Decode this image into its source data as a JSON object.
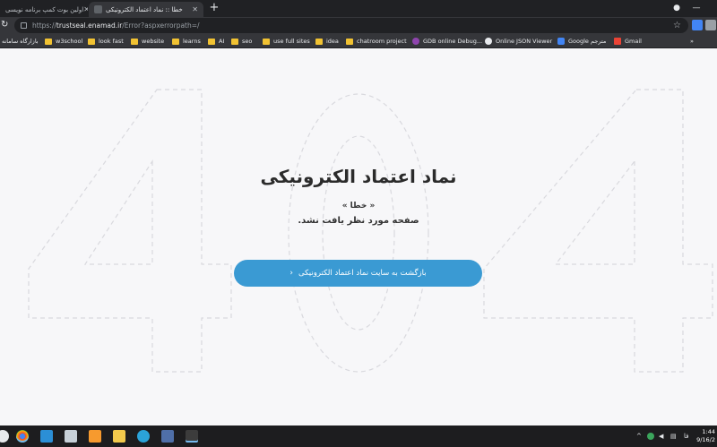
{
  "tabs": [
    {
      "label": "اولین بوت کمپ برنامه نویسی",
      "active": false
    },
    {
      "label": "خطا :: نماد اعتماد الکترونیکی",
      "active": true
    }
  ],
  "address_bar": {
    "scheme": "https://",
    "host": "trustseal.enamad.ir",
    "path": "/Error?aspxerrorpath=/"
  },
  "bookmarks": [
    {
      "label": "بازارگاه سامانه",
      "icon": "folder"
    },
    {
      "label": "w3school",
      "icon": "folder"
    },
    {
      "label": "look fast",
      "icon": "folder"
    },
    {
      "label": "website",
      "icon": "folder"
    },
    {
      "label": "learns",
      "icon": "folder"
    },
    {
      "label": "AI",
      "icon": "folder"
    },
    {
      "label": "seo",
      "icon": "folder"
    },
    {
      "label": "use full sites",
      "icon": "folder"
    },
    {
      "label": "idea",
      "icon": "folder"
    },
    {
      "label": "chatroom project",
      "icon": "folder"
    },
    {
      "label": "GDB online Debug...",
      "icon": "gdb-icon"
    },
    {
      "label": "Online JSON Viewer",
      "icon": "json-icon"
    },
    {
      "label": "Google مترجم",
      "icon": "translate-icon"
    },
    {
      "label": "Gmail",
      "icon": "gmail-icon"
    }
  ],
  "page": {
    "title": "نماد اعتماد الکترونیکی",
    "error_label": "« خطا »",
    "message": "صفحه مورد نظر یافت نشد.",
    "back_button": "بازگشت به سایت نماد اعتماد الکترونیکی"
  },
  "taskbar": {
    "clock_time": "1:44",
    "clock_date": "9/16/2",
    "language": "فا"
  },
  "colors": {
    "accent": "#3a9ad3",
    "chrome_dark": "#202124",
    "chrome_toolbar": "#35363a",
    "page_bg": "#f7f7f9"
  }
}
